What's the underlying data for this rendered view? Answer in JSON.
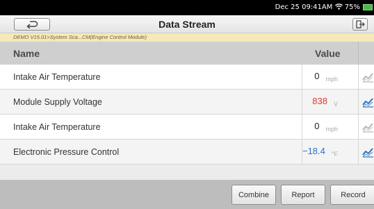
{
  "status_bar": {
    "time": "Dec 25 09:41AM",
    "battery": "75%"
  },
  "header": {
    "title": "Data Stream"
  },
  "breadcrumb": "DEMO V15.01>System Sca...CM(Engine Control Module)",
  "table": {
    "col_name": "Name",
    "col_value": "Value",
    "rows": [
      {
        "name": "Intake Air Temperature",
        "value": "0",
        "unit": "mph",
        "value_color": "#222222",
        "graph_active": false
      },
      {
        "name": "Module Supply Voltage",
        "value": "838",
        "unit": "V",
        "value_color": "#e03a2e",
        "graph_active": true
      },
      {
        "name": "Intake Air Temperature",
        "value": "0",
        "unit": "mph",
        "value_color": "#222222",
        "graph_active": false
      },
      {
        "name": "Electronic Pressure Control",
        "value": "−18.4",
        "unit": "°F",
        "value_color": "#2a72c8",
        "graph_active": true
      }
    ]
  },
  "buttons": {
    "combine": "Combine",
    "report": "Report",
    "record": "Record"
  }
}
